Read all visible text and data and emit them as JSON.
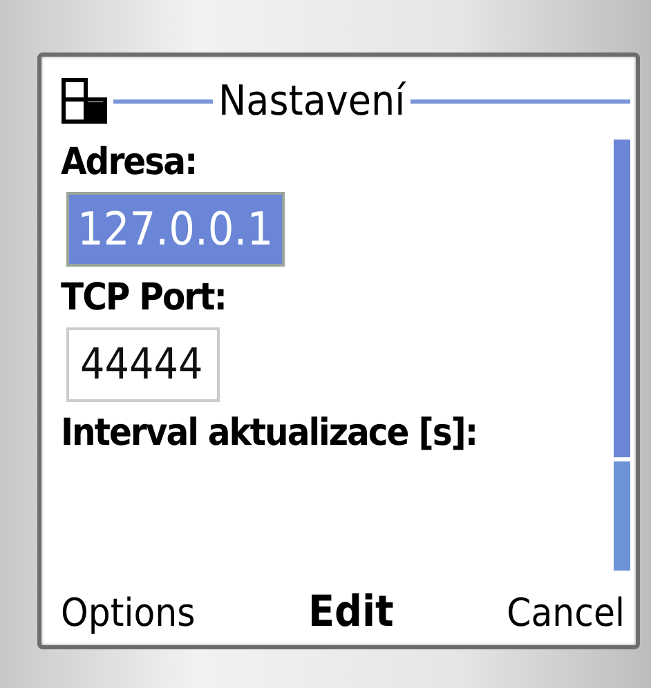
{
  "window": {
    "title": "Nastavení"
  },
  "fields": [
    {
      "label": "Adresa:",
      "value": "127.0.0.1",
      "selected": true
    },
    {
      "label": "TCP Port:",
      "value": "44444",
      "selected": false
    },
    {
      "label": "Interval aktualizace [s]:"
    }
  ],
  "softkeys": {
    "left": "Options",
    "middle": "Edit",
    "right": "Cancel"
  }
}
